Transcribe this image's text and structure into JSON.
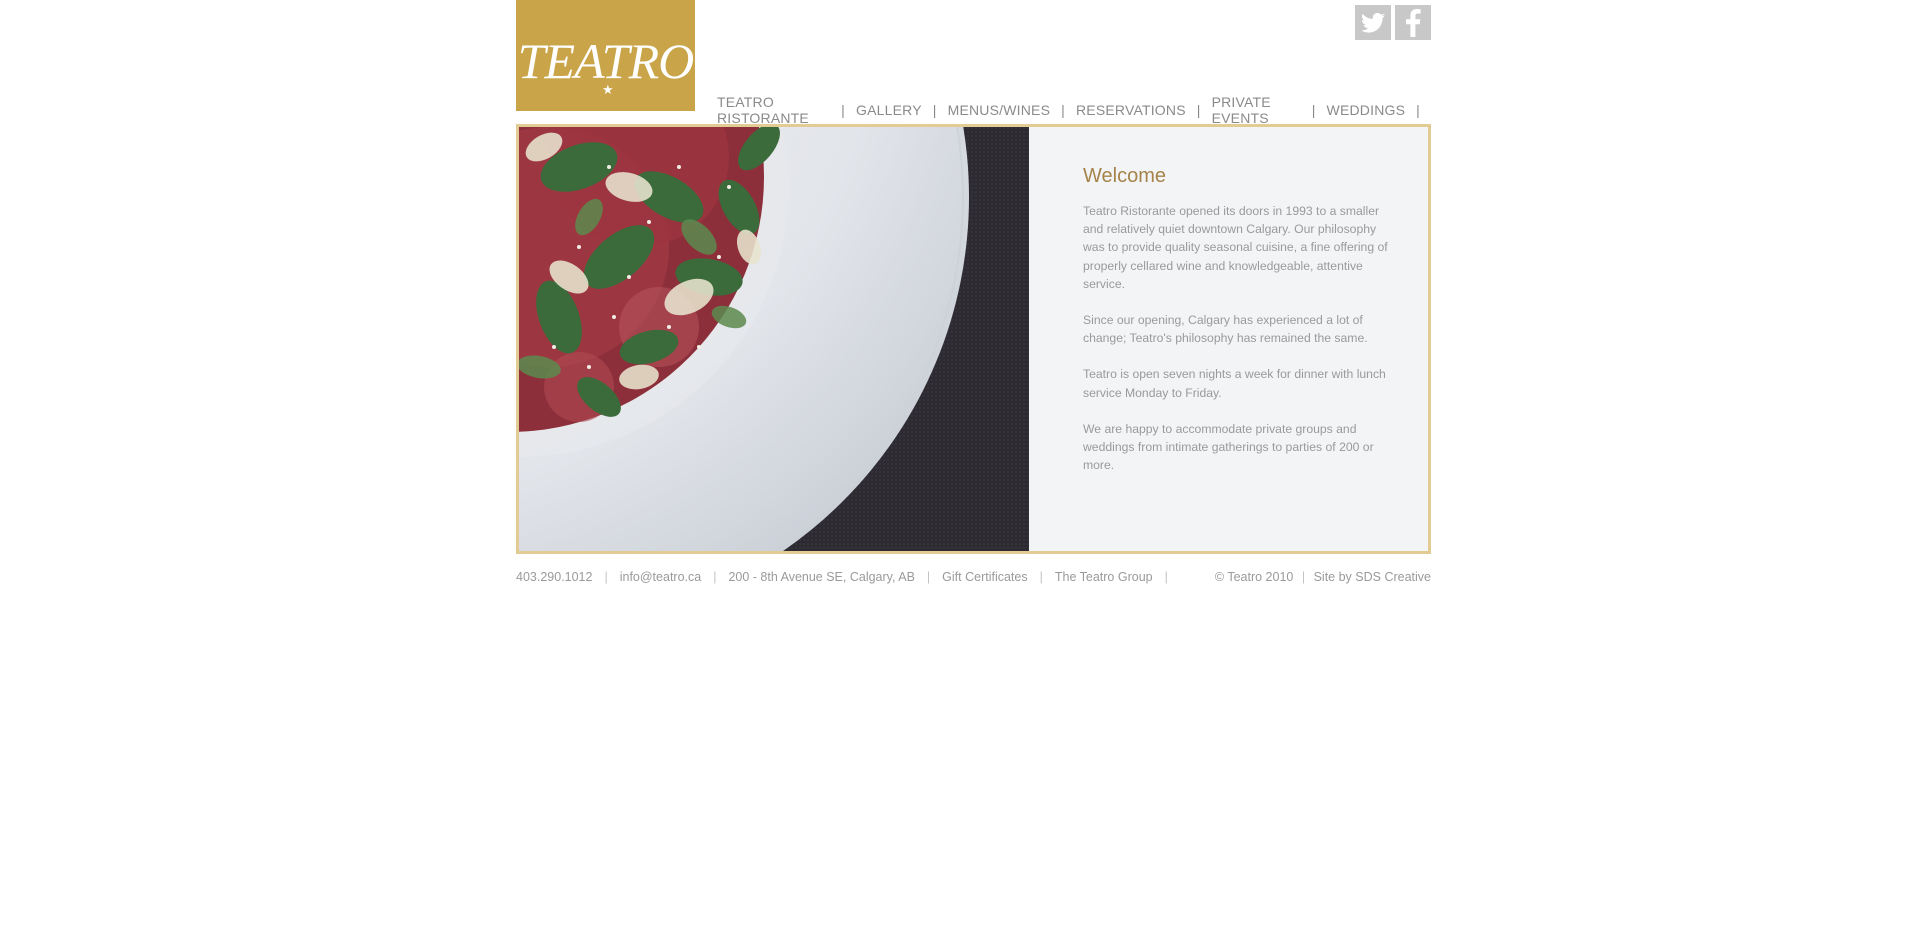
{
  "logo": {
    "text": "TEATRO",
    "star": "★",
    "color": "#c9a449"
  },
  "social": [
    {
      "name": "twitter-icon"
    },
    {
      "name": "facebook-icon"
    }
  ],
  "nav": {
    "items": [
      {
        "label": "TEATRO RISTORANTE"
      },
      {
        "label": "GALLERY"
      },
      {
        "label": "MENUS/WINES"
      },
      {
        "label": "RESERVATIONS"
      },
      {
        "label": "PRIVATE EVENTS"
      },
      {
        "label": "WEDDINGS"
      }
    ],
    "separator": "|"
  },
  "welcome": {
    "title": "Welcome",
    "paragraphs": [
      "Teatro Ristorante opened its doors in 1993 to a smaller and relatively quiet downtown Calgary. Our philosophy was to provide quality seasonal cuisine, a fine offering of properly cellared wine and knowledgeable, attentive service.",
      "Since our opening, Calgary has experienced a lot of change; Teatro's philosophy has remained the same.",
      "Teatro is open seven nights a week for dinner with lunch service Monday to Friday.",
      "We are happy to accommodate private groups and weddings from intimate gatherings to parties of 200 or more."
    ]
  },
  "footer": {
    "phone": "403.290.1012",
    "email": "info@teatro.ca",
    "address": "200 - 8th Avenue SE, Calgary, AB",
    "gift": "Gift Certificates",
    "group": "The Teatro Group",
    "copyright": "© Teatro 2010",
    "credit": "Site by SDS Creative",
    "separator": "|"
  },
  "colors": {
    "accent": "#c9a449",
    "border": "#e2cc93",
    "heading": "#a6834a",
    "text": "#9a9a9a"
  }
}
